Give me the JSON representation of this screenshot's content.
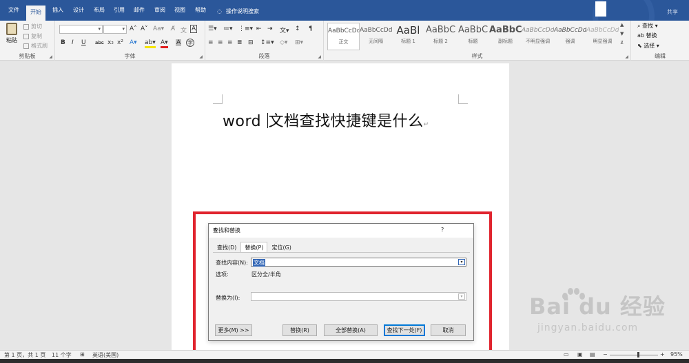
{
  "tabs": [
    "文件",
    "开始",
    "插入",
    "设计",
    "布局",
    "引用",
    "邮件",
    "审阅",
    "视图",
    "帮助"
  ],
  "active_tab": "开始",
  "tell_me": "操作说明搜索",
  "share": "共享",
  "ribbon": {
    "clipboard": {
      "paste": "粘贴",
      "cut": "剪切",
      "copy": "复制",
      "format_painter": "格式刷",
      "label": "剪贴板"
    },
    "font": {
      "label": "字体",
      "bold": "B",
      "italic": "I",
      "underline": "U",
      "strike": "abc",
      "sub": "x₂",
      "sup": "x²"
    },
    "paragraph": {
      "label": "段落"
    },
    "styles": {
      "label": "样式",
      "items": [
        {
          "sample": "AaBbCcDd",
          "name": "正文"
        },
        {
          "sample": "AaBbCcDd",
          "name": "无间隔"
        },
        {
          "sample": "AaBl",
          "name": "标题 1"
        },
        {
          "sample": "AaBbC",
          "name": "标题 2"
        },
        {
          "sample": "AaBbC",
          "name": "标题"
        },
        {
          "sample": "AaBbC",
          "name": "副标题"
        },
        {
          "sample": "AaBbCcDd",
          "name": "不明显强调"
        },
        {
          "sample": "AaBbCcDd",
          "name": "强调"
        },
        {
          "sample": "AaBbCcDd",
          "name": "明显强调"
        }
      ]
    },
    "editing": {
      "find": "查找",
      "replace": "替换",
      "select": "选择",
      "label": "编辑"
    }
  },
  "document": {
    "text_before": "word ",
    "text_after": "文档查找快捷键是什么"
  },
  "dialog": {
    "title": "查找和替换",
    "help": "?",
    "close": "✕",
    "tabs": [
      "查找(D)",
      "替换(P)",
      "定位(G)"
    ],
    "active_tab": "替换(P)",
    "find_label": "查找内容(N):",
    "find_value": "文档",
    "options_label": "选项:",
    "options_value": "区分全/半角",
    "replace_label": "替换为(I):",
    "replace_value": "",
    "buttons": {
      "more": "更多(M) >>",
      "replace": "替换(R)",
      "replace_all": "全部替换(A)",
      "find_next": "查找下一处(F)",
      "cancel": "取消"
    }
  },
  "status": {
    "page": "第 1 页，共 1 页",
    "words": "11 个字",
    "language": "英语(美国)",
    "zoom": "95%"
  },
  "watermark": {
    "main": "Bai du 经验",
    "sub": "jingyan.baidu.com"
  }
}
